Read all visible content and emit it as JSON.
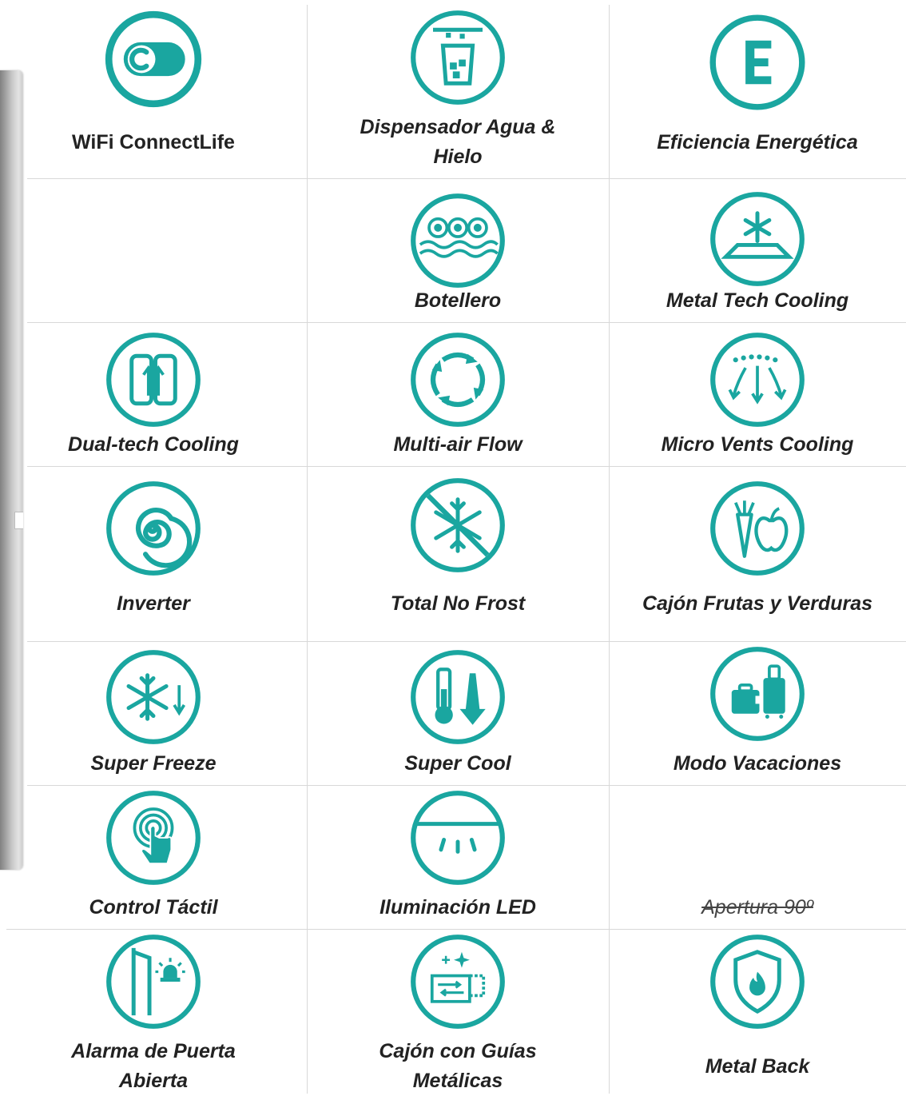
{
  "colors": {
    "accent": "#1aa6a0",
    "text": "#222222",
    "divider": "#d8d8d8"
  },
  "features": [
    {
      "label": "WiFi ConnectLife",
      "icon": "connectlife-toggle-icon"
    },
    {
      "label": "Dispensador Agua & Hielo",
      "icon": "water-ice-dispenser-icon"
    },
    {
      "label": "Eficiencia Energética",
      "icon": "energy-efficiency-e-icon"
    },
    {
      "label": "",
      "icon": ""
    },
    {
      "label": "Botellero",
      "icon": "bottle-rack-icon"
    },
    {
      "label": "Metal Tech Cooling",
      "icon": "metal-tech-cooling-icon"
    },
    {
      "label": "Dual-tech Cooling",
      "icon": "dual-tech-cooling-icon"
    },
    {
      "label": "Multi-air Flow",
      "icon": "multi-air-flow-icon"
    },
    {
      "label": "Micro Vents Cooling",
      "icon": "micro-vents-cooling-icon"
    },
    {
      "label": "Inverter",
      "icon": "inverter-spiral-icon"
    },
    {
      "label": "Total No Frost",
      "icon": "no-frost-icon"
    },
    {
      "label": "Cajón Frutas y Verduras",
      "icon": "fruit-vegetable-drawer-icon"
    },
    {
      "label": "Super Freeze",
      "icon": "super-freeze-icon"
    },
    {
      "label": "Super Cool",
      "icon": "super-cool-icon"
    },
    {
      "label": "Modo Vacaciones",
      "icon": "vacation-mode-luggage-icon"
    },
    {
      "label": "Control Táctil",
      "icon": "touch-control-icon"
    },
    {
      "label": "Iluminación LED",
      "icon": "led-lighting-icon"
    },
    {
      "label": "Apertura 90º",
      "icon": ""
    },
    {
      "label": "Alarma de Puerta Abierta",
      "icon": "door-alarm-icon"
    },
    {
      "label": "Cajón con Guías Metálicas",
      "icon": "metal-rail-drawer-icon"
    },
    {
      "label": "Metal Back",
      "icon": "metal-back-shield-icon"
    }
  ]
}
